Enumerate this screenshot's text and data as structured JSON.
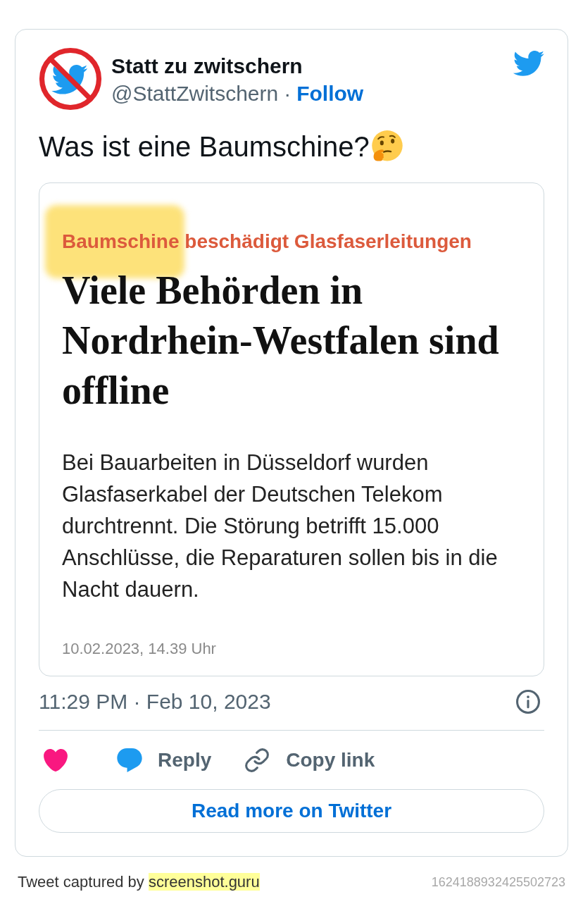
{
  "tweet": {
    "author": {
      "name": "Statt zu zwitschern",
      "handle": "@StattZwitschern",
      "separator": "·",
      "follow": "Follow"
    },
    "text": "Was ist eine Baumschine?",
    "media": {
      "kicker": "Baumschine beschädigt Glasfaserleitungen",
      "headline": "Viele Behörden in Nordrhein-Westfalen sind offline",
      "body": "Bei Bauarbeiten in Düsseldorf wurden Glasfaserkabel der Deutschen Telekom durchtrennt. Die Störung betrifft 15.000 Anschlüsse, die Reparaturen sollen bis in die Nacht dauern.",
      "date": "10.02.2023, 14.39 Uhr"
    },
    "timestamp": "11:29 PM · Feb 10, 2023",
    "actions": [
      {
        "kind": "like"
      },
      {
        "kind": "reply",
        "label": "Reply"
      },
      {
        "kind": "copy_link",
        "label": "Copy link"
      }
    ],
    "read_more": "Read more on Twitter"
  },
  "footer": {
    "caption": "Tweet captured by",
    "link": "screenshot.guru",
    "tweet_id": "1624188932425502723"
  }
}
